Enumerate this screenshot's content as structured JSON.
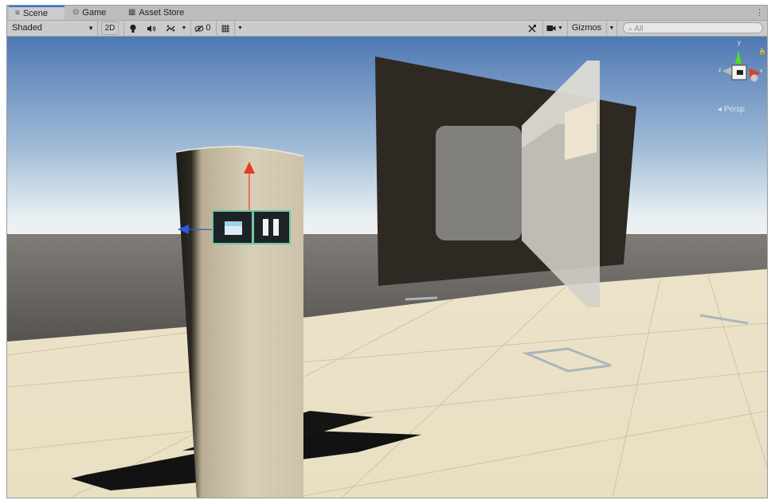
{
  "tabs": [
    {
      "label": "Scene",
      "icon": "hash-icon",
      "active": true
    },
    {
      "label": "Game",
      "icon": "gamepad-icon",
      "active": false
    },
    {
      "label": "Asset Store",
      "icon": "bag-icon",
      "active": false
    }
  ],
  "toolbar": {
    "draw_mode": "Shaded",
    "btn_2d": "2D",
    "hidden_count": "0",
    "gizmos_label": "Gizmos",
    "search_placeholder": "All"
  },
  "viewport": {
    "projection_label": "Persp"
  },
  "colors": {
    "accent": "#3a72d8",
    "sky_top": "#4f79b3",
    "horizon": "#e7eef2",
    "floor": "#eae0c4",
    "wall": "#2c2721",
    "pillar": "#d6ccb4",
    "gizmo_y": "#4fdb27",
    "gizmo_x": "#e23b26",
    "gizmo_z": "#2a5bd8"
  }
}
